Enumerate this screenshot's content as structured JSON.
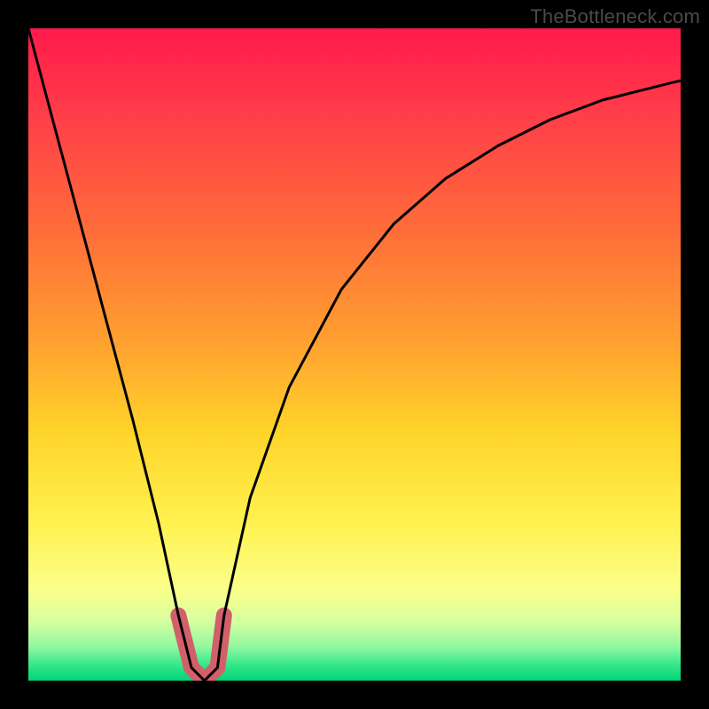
{
  "watermark": {
    "text": "TheBottleneck.com"
  },
  "colors": {
    "frame": "#000000",
    "curve": "#000000",
    "notch": "#d1606a",
    "gradient_stops": [
      {
        "offset": 0.0,
        "color": "#ff1a4b"
      },
      {
        "offset": 0.12,
        "color": "#ff3a4a"
      },
      {
        "offset": 0.3,
        "color": "#ff6a3a"
      },
      {
        "offset": 0.48,
        "color": "#ffa030"
      },
      {
        "offset": 0.62,
        "color": "#ffd42a"
      },
      {
        "offset": 0.76,
        "color": "#fff250"
      },
      {
        "offset": 0.86,
        "color": "#fbff8a"
      },
      {
        "offset": 0.91,
        "color": "#d6ffa0"
      },
      {
        "offset": 0.95,
        "color": "#8cf7a0"
      },
      {
        "offset": 0.975,
        "color": "#36e88a"
      },
      {
        "offset": 1.0,
        "color": "#00d476"
      }
    ]
  },
  "chart_data": {
    "type": "line",
    "title": "",
    "xlabel": "",
    "ylabel": "",
    "xlim": [
      0,
      100
    ],
    "ylim": [
      0,
      100
    ],
    "grid": false,
    "legend": false,
    "series": [
      {
        "name": "bottleneck-curve",
        "x": [
          0,
          4,
          8,
          12,
          16,
          20,
          23,
          25,
          27,
          29,
          30,
          34,
          40,
          48,
          56,
          64,
          72,
          80,
          88,
          96,
          100
        ],
        "y": [
          100,
          85,
          70,
          55,
          40,
          24,
          10,
          2,
          0,
          2,
          10,
          28,
          45,
          60,
          70,
          77,
          82,
          86,
          89,
          91,
          92
        ]
      }
    ],
    "notch": {
      "x_range": [
        23,
        30
      ],
      "y_range": [
        0,
        10
      ]
    },
    "background": "vertical-gradient red→orange→yellow→green"
  }
}
